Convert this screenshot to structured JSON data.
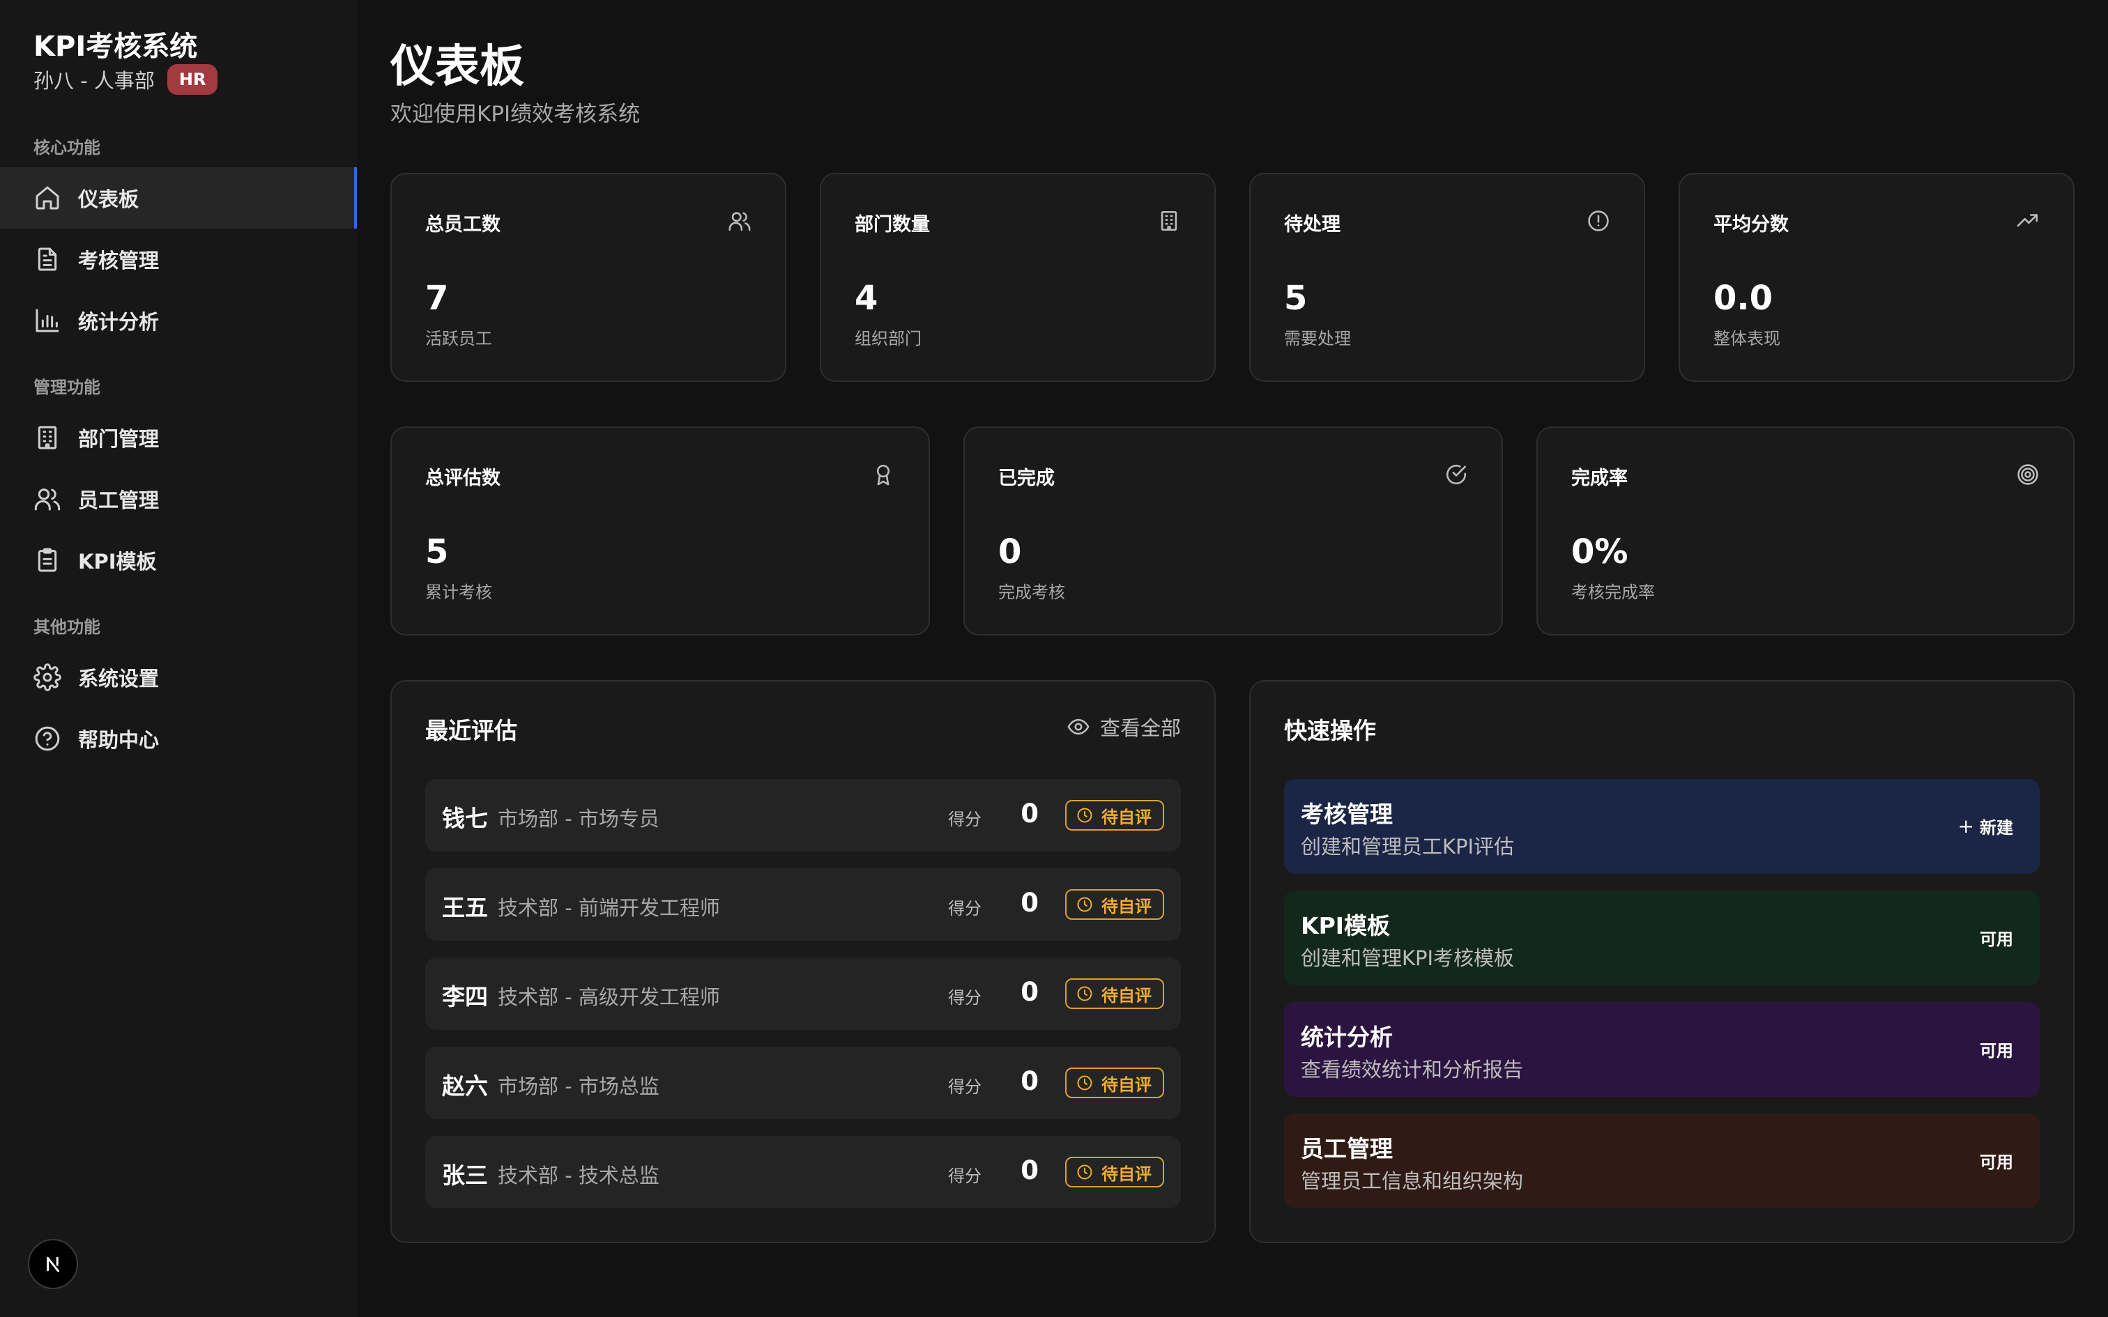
{
  "sidebar": {
    "app_title": "KPI考核系统",
    "user": "孙八 - 人事部",
    "role_badge": "HR",
    "sections": [
      {
        "label": "核心功能",
        "items": [
          {
            "label": "仪表板",
            "icon": "home-icon",
            "active": true
          },
          {
            "label": "考核管理",
            "icon": "document-icon"
          },
          {
            "label": "统计分析",
            "icon": "bar-chart-icon"
          }
        ]
      },
      {
        "label": "管理功能",
        "items": [
          {
            "label": "部门管理",
            "icon": "building-icon"
          },
          {
            "label": "员工管理",
            "icon": "users-icon"
          },
          {
            "label": "KPI模板",
            "icon": "clipboard-icon"
          }
        ]
      },
      {
        "label": "其他功能",
        "items": [
          {
            "label": "系统设置",
            "icon": "gear-icon"
          },
          {
            "label": "帮助中心",
            "icon": "help-circle-icon"
          }
        ]
      }
    ],
    "footer_badge": "N"
  },
  "header": {
    "title": "仪表板",
    "subtitle": "欢迎使用KPI绩效考核系统"
  },
  "stats_row1": [
    {
      "title": "总员工数",
      "value": "7",
      "desc": "活跃员工",
      "icon": "users-icon"
    },
    {
      "title": "部门数量",
      "value": "4",
      "desc": "组织部门",
      "icon": "building-icon"
    },
    {
      "title": "待处理",
      "value": "5",
      "desc": "需要处理",
      "icon": "alert-circle-icon"
    },
    {
      "title": "平均分数",
      "value": "0.0",
      "desc": "整体表现",
      "icon": "trending-up-icon"
    }
  ],
  "stats_row2": [
    {
      "title": "总评估数",
      "value": "5",
      "desc": "累计考核",
      "icon": "award-icon"
    },
    {
      "title": "已完成",
      "value": "0",
      "desc": "完成考核",
      "icon": "check-circle-icon"
    },
    {
      "title": "完成率",
      "value": "0%",
      "desc": "考核完成率",
      "icon": "target-icon"
    }
  ],
  "recent": {
    "title": "最近评估",
    "view_all": "查看全部",
    "score_label": "得分",
    "rows": [
      {
        "name": "钱七",
        "dept": "市场部 - 市场专员",
        "score": "0",
        "status": "待自评"
      },
      {
        "name": "王五",
        "dept": "技术部 - 前端开发工程师",
        "score": "0",
        "status": "待自评"
      },
      {
        "name": "李四",
        "dept": "技术部 - 高级开发工程师",
        "score": "0",
        "status": "待自评"
      },
      {
        "name": "赵六",
        "dept": "市场部 - 市场总监",
        "score": "0",
        "status": "待自评"
      },
      {
        "name": "张三",
        "dept": "技术部 - 技术总监",
        "score": "0",
        "status": "待自评"
      }
    ]
  },
  "quick": {
    "title": "快速操作",
    "items": [
      {
        "title": "考核管理",
        "desc": "创建和管理员工KPI评估",
        "action": "新建",
        "color": "#1b2545"
      },
      {
        "title": "KPI模板",
        "desc": "创建和管理KPI考核模板",
        "action": "可用",
        "color": "#13281c"
      },
      {
        "title": "统计分析",
        "desc": "查看绩效统计和分析报告",
        "action": "可用",
        "color": "#2c1440"
      },
      {
        "title": "员工管理",
        "desc": "管理员工信息和组织架构",
        "action": "可用",
        "color": "#301a14"
      }
    ]
  },
  "colors": {
    "accent": "#3b63e0",
    "hr_badge": "#a33a40",
    "pending": "#f0ad2e"
  }
}
